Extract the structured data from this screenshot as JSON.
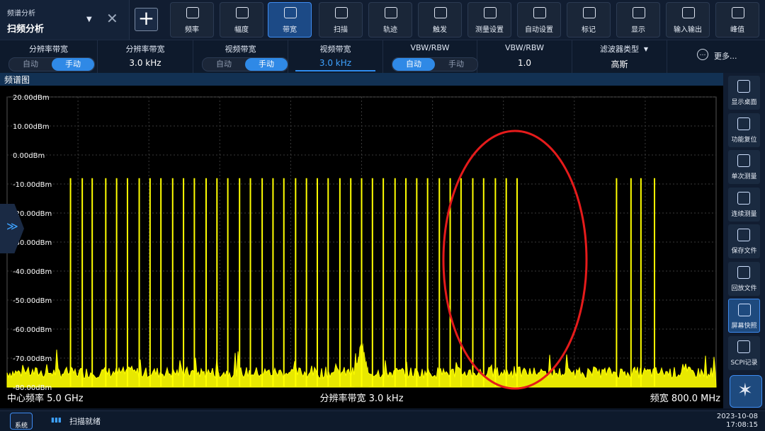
{
  "mode": {
    "small_label": "频谱分析",
    "big_label": "扫频分析"
  },
  "tabs": [
    {
      "label": "频率"
    },
    {
      "label": "幅度"
    },
    {
      "label": "带宽",
      "active": true
    },
    {
      "label": "扫描"
    },
    {
      "label": "轨迹"
    },
    {
      "label": "触发"
    },
    {
      "label": "测量设置"
    },
    {
      "label": "自动设置"
    },
    {
      "label": "标记"
    },
    {
      "label": "显示"
    },
    {
      "label": "输入输出"
    },
    {
      "label": "峰值"
    }
  ],
  "settings": [
    {
      "title": "分辨率带宽",
      "toggle": [
        "自动",
        "手动"
      ],
      "on": 1
    },
    {
      "title": "分辨率带宽",
      "value": "3.0 kHz"
    },
    {
      "title": "视频带宽",
      "toggle": [
        "自动",
        "手动"
      ],
      "on": 1
    },
    {
      "title": "视频带宽",
      "value": "3.0 kHz",
      "selected": true
    },
    {
      "title": "VBW/RBW",
      "toggle": [
        "自动",
        "手动"
      ],
      "on": 0
    },
    {
      "title": "VBW/RBW",
      "value": "1.0"
    },
    {
      "title": "滤波器类型",
      "value": "高斯"
    }
  ],
  "more_label": "更多...",
  "plot": {
    "title": "频谱图",
    "ref_levels": [
      "20.00dBm",
      "10.00dBm",
      "0.00dBm",
      "-10.00dBm",
      "-20.00dBm",
      "-30.00dBm",
      "-40.00dBm",
      "-50.00dBm",
      "-60.00dBm",
      "-70.00dBm",
      "-80.00dBm"
    ],
    "center_label": "中心频率 5.0 GHz",
    "rbw_label": "分辨率带宽 3.0 kHz",
    "span_label": "频宽 800.0 MHz"
  },
  "right_buttons": [
    {
      "label": "显示桌面"
    },
    {
      "label": "功能复位"
    },
    {
      "label": "单次测量"
    },
    {
      "label": "连续测量"
    },
    {
      "label": "保存文件"
    },
    {
      "label": "回放文件"
    },
    {
      "label": "屏幕快照",
      "highlight": true
    },
    {
      "label": "SCPI记录"
    }
  ],
  "bottom": {
    "sys_label": "系统",
    "status": "扫描就绪",
    "date": "2023-10-08",
    "time": "17:08:15"
  },
  "chart_data": {
    "type": "line",
    "ylabel": "dBm",
    "ylim": [
      -80,
      20
    ],
    "grid": true,
    "tone_level_dbm": -8,
    "noise_floor_dbm": -75,
    "tones_center_mhz": [
      -322,
      -309,
      -298,
      -283,
      -271,
      -259,
      -246,
      -234,
      -222,
      -209,
      -197,
      -185,
      -172,
      -160,
      -148,
      -135,
      -123,
      -110,
      -98,
      -86,
      -73,
      -61,
      -49,
      -37,
      -24,
      -12,
      0,
      12,
      24,
      37,
      49,
      61,
      73,
      86,
      98,
      110,
      123,
      135,
      148,
      160,
      172,
      282,
      298,
      309,
      324
    ]
  }
}
